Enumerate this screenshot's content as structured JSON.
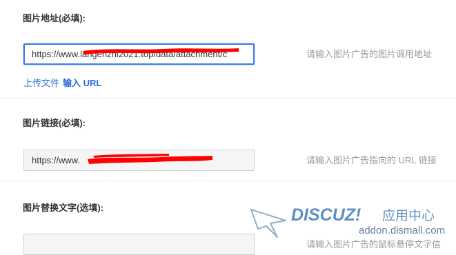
{
  "sections": [
    {
      "label": "图片地址(必填):",
      "value": "https://www.langenzhi2021.top/data/attachment/c",
      "hint": "请输入图片广告的图片调用地址"
    },
    {
      "label": "图片链接(必填):",
      "value": "https://www.",
      "hint": "请输入图片广告指向的 URL 链接"
    },
    {
      "label": "图片替换文字(选填):",
      "value": "",
      "hint": "请输入图片广告的鼠标悬停文字信"
    }
  ],
  "links": {
    "upload": "上传文件",
    "input_url": "输入 URL"
  },
  "watermark": {
    "brand": "DISCUZ!",
    "brand_cn": "应用中心",
    "domain": "addon.dismall.com"
  },
  "colors": {
    "link": "#2b6cd6",
    "focus_border": "#3f7ee8",
    "redaction": "#ff0000",
    "watermark": "#1f63ae"
  }
}
